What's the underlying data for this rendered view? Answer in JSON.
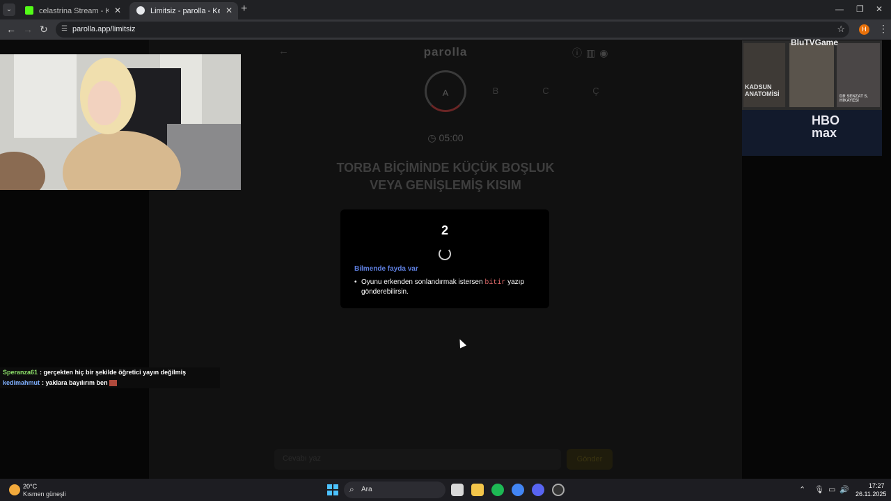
{
  "browser": {
    "tabs": [
      {
        "label": "celastrina Stream - Kick Dashboard",
        "favicon_color": "#53fc18"
      },
      {
        "label": "Limitsiz - parolla - Kelime oyunu",
        "favicon_color": "#ffffff"
      }
    ],
    "url": "parolla.app/limitsiz",
    "profile_initial": "H"
  },
  "game": {
    "brand": "parolla",
    "letters": [
      "A",
      "B",
      "C",
      "Ç"
    ],
    "active_letter": "A",
    "timer": "05:00",
    "question_line1": "TORBA BİÇİMİNDE KÜÇÜK BOŞLUK",
    "question_line2": "VEYA GENİŞLEMİŞ KISIM",
    "modal": {
      "countdown": "2",
      "tip_title": "Bilmende fayda var",
      "tip_text_before": "Oyunu erkenden sonlandırmak istersen",
      "tip_keyword": "bitir",
      "tip_text_after": "yazıp gönderebilirsin."
    },
    "input_placeholder": "Cevabı yaz",
    "submit_label": "Gönder"
  },
  "ad": {
    "brand": "BluTVGame",
    "show_title": "KADSUN ANATOMİSİ",
    "network": "HBO max",
    "side_text": "DR SENZAT S. HİKAYESİ"
  },
  "chat": [
    {
      "user": "Speranza61",
      "user_color": "#8fe36b",
      "message": "gerçekten hiç bir şekilde öğretici yayın değilmiş"
    },
    {
      "user": "kedimahmut",
      "user_color": "#7fb0ff",
      "message": "yaklara bayılırım ben"
    }
  ],
  "taskbar": {
    "temperature": "20°C",
    "weather": "Kısmen güneşli",
    "search_placeholder": "Ara",
    "time": "17:27",
    "date": "26.11.2025"
  }
}
